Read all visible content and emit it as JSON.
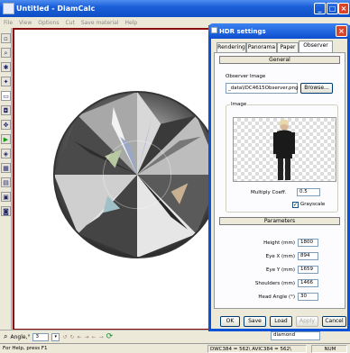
{
  "window": {
    "title": "Untitled - DiamCalc"
  },
  "menu": [
    "File",
    "View",
    "Options",
    "Cut",
    "Save material",
    "Help"
  ],
  "toolbar": {
    "angle_label": "Angle,°",
    "angle_value": "3",
    "material_value": "diamond"
  },
  "status": {
    "help": "For Help, press F1",
    "dims": "DWC384 = 562\\ AVIC384 = 562\\",
    "num": "NUM"
  },
  "dialog": {
    "title": "HDR settings",
    "tabs": [
      "Rendering",
      "Panorama",
      "Paper",
      "Observer"
    ],
    "active_tab": "Observer",
    "general_header": "General",
    "observer_image_label": "Observer Image",
    "observer_image_path": "_data\\IDC4615Observer.png",
    "browse_label": "Browse...",
    "image_label": "Image",
    "multiply_label": "Multiply Coeff.",
    "multiply_value": "0.5",
    "grayscale_label": "Grayscale",
    "grayscale_checked": true,
    "parameters_header": "Parameters",
    "params": [
      {
        "label": "Height (mm)",
        "value": "1800"
      },
      {
        "label": "Eye X (mm)",
        "value": "894"
      },
      {
        "label": "Eye Y (mm)",
        "value": "1659"
      },
      {
        "label": "Shoulders (mm)",
        "value": "1466"
      },
      {
        "label": "Head Angle (°)",
        "value": "30"
      }
    ],
    "buttons": {
      "ok": "OK",
      "save": "Save",
      "load": "Load",
      "apply": "Apply",
      "cancel": "Cancel"
    }
  },
  "colors": {
    "titlebar": "#0e4fc6",
    "canvas_border": "#8a0e0e",
    "dialog_border": "#0a52d8"
  }
}
